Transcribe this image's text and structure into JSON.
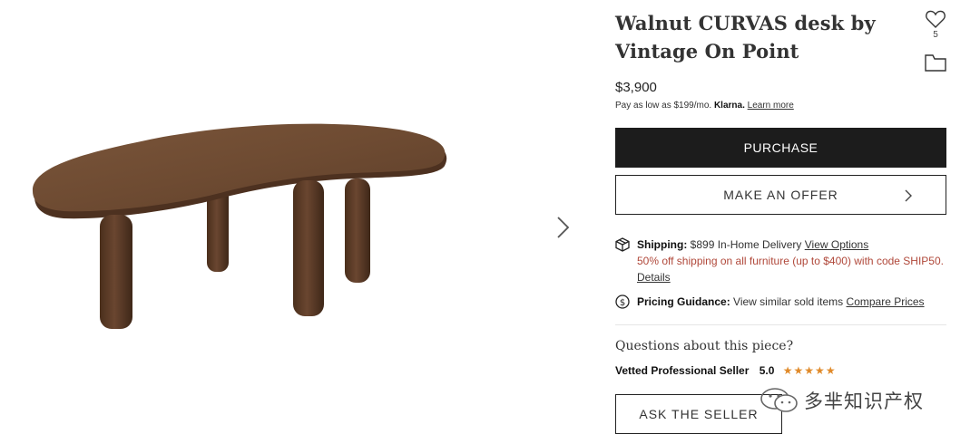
{
  "product": {
    "title": "Walnut CURVAS desk by Vintage On Point",
    "price": "$3,900",
    "favorite_count": "5",
    "klarna": {
      "text": "Pay as low as $199/mo.",
      "brand": "Klarna.",
      "link": "Learn more"
    }
  },
  "actions": {
    "purchase_label": "PURCHASE",
    "offer_label": "MAKE AN OFFER",
    "ask_label": "ASK THE SELLER"
  },
  "shipping": {
    "label": "Shipping:",
    "text": "$899 In-Home Delivery",
    "link": "View Options",
    "promo": "50% off shipping on all furniture (up to $400) with code SHIP50.",
    "details_link": "Details"
  },
  "pricing": {
    "label": "Pricing Guidance:",
    "text": "View similar sold items",
    "link": "Compare Prices"
  },
  "seller": {
    "questions": "Questions about this piece?",
    "name": "Vetted Professional Seller",
    "rating": "5.0",
    "stars": "★★★★★"
  },
  "watermark": {
    "text": "多芈知识产权"
  },
  "icons": {
    "heart": "heart-icon",
    "folder": "folder-icon",
    "next": "chevron-right-icon",
    "shipping": "package-icon",
    "pricing": "dollar-circle-icon"
  },
  "colors": {
    "purchase_bg": "#1c1c1c",
    "promo": "#b0483a",
    "stars": "#e08a2a",
    "wood": "#6b4a30"
  }
}
